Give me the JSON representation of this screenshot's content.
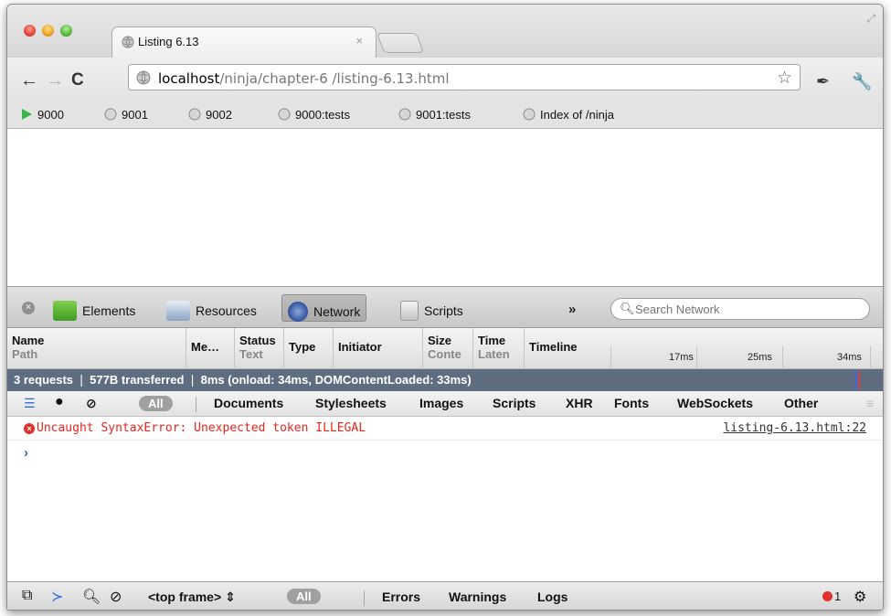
{
  "tab": {
    "title": "Listing 6.13",
    "close": "×"
  },
  "omnibox": {
    "host": "localhost",
    "path": "/ninja/chapter-6 /listing-6.13.html"
  },
  "bookmarks": [
    {
      "label": "9000",
      "icon": "play-icon"
    },
    {
      "label": "9001",
      "icon": "globe-icon"
    },
    {
      "label": "9002",
      "icon": "globe-icon"
    },
    {
      "label": "9000:tests",
      "icon": "globe-icon"
    },
    {
      "label": "9001:tests",
      "icon": "globe-icon"
    },
    {
      "label": "Index of /ninja",
      "icon": "globe-icon"
    }
  ],
  "devtools": {
    "tabs": [
      {
        "label": "Elements",
        "icon": "elements-icon",
        "selected": false
      },
      {
        "label": "Resources",
        "icon": "resources-icon",
        "selected": false
      },
      {
        "label": "Network",
        "icon": "network-icon",
        "selected": true
      },
      {
        "label": "Scripts",
        "icon": "scripts-icon",
        "selected": false
      }
    ],
    "overflow": "»",
    "search_placeholder": "Search Network"
  },
  "network": {
    "columns": [
      {
        "title": "Name",
        "sub": "Path"
      },
      {
        "title": "Me…",
        "sub": ""
      },
      {
        "title": "Status",
        "sub": "Text"
      },
      {
        "title": "Type",
        "sub": ""
      },
      {
        "title": "Initiator",
        "sub": ""
      },
      {
        "title": "Size",
        "sub": "Conte"
      },
      {
        "title": "Time",
        "sub": "Laten"
      },
      {
        "title": "Timeline",
        "sub": ""
      }
    ],
    "timeline_ticks": [
      "17ms",
      "25ms",
      "34ms"
    ],
    "summary": "3 requests  ❘  577B transferred  ❘  8ms (onload: 34ms, DOMContentLoaded: 33ms)"
  },
  "filters": {
    "all": "All",
    "types": [
      "Documents",
      "Stylesheets",
      "Images",
      "Scripts",
      "XHR",
      "Fonts",
      "WebSockets",
      "Other"
    ]
  },
  "console": {
    "error_message": "Uncaught SyntaxError: Unexpected token ILLEGAL",
    "error_source": "listing-6.13.html:22",
    "prompt": "›"
  },
  "statusbar": {
    "frame": "<top frame>",
    "all": "All",
    "levels": [
      "Errors",
      "Warnings",
      "Logs"
    ],
    "error_count": "1"
  },
  "colors": {
    "summary_bg": "#5e6d80",
    "error_red": "#e5261c",
    "prompt_blue": "#2f6ad8"
  }
}
